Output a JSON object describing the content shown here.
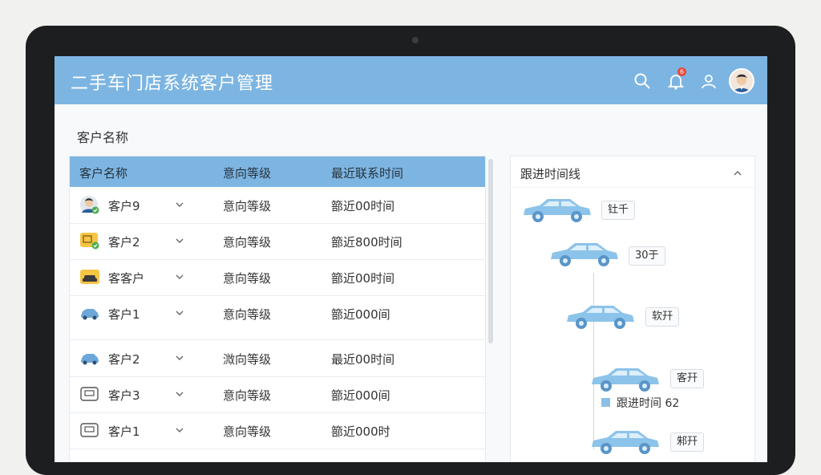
{
  "header": {
    "title": "二手车门店系统客户管理",
    "notification_count": "6"
  },
  "section_label": "客户名称",
  "table": {
    "headers": [
      "客户名称",
      "意向等级",
      "最近联系时间"
    ],
    "rows": [
      {
        "icon": "person-avatar-icon",
        "name": "客户9",
        "level": "意向等级",
        "time": "篰近00时间"
      },
      {
        "icon": "id-card-icon",
        "name": "客户2",
        "level": "意向等级",
        "time": "篰近800时间"
      },
      {
        "icon": "yellow-car-icon",
        "name": "客客户",
        "level": "意向等级",
        "time": "篰近00时间"
      },
      {
        "icon": "blue-car-icon",
        "name": "客户1",
        "level": "意向等级",
        "time": "篰近000间"
      },
      {
        "icon": "blue-car-icon",
        "name": "客户2",
        "level": "溦向等级",
        "time": "最近00时间"
      },
      {
        "icon": "card-icon",
        "name": "客户3",
        "level": "意向等级",
        "time": "篰近000间"
      },
      {
        "icon": "card-icon",
        "name": "客户1",
        "level": "意向等级",
        "time": "篰近000时"
      }
    ]
  },
  "timeline": {
    "title": "跟进时间线",
    "tags": [
      "钍千",
      "30于",
      "软幵",
      "客幵",
      "邾幵"
    ],
    "note": "跟进时间 62"
  },
  "colors": {
    "header_bg": "#7db5e2",
    "car_blue": "#8cc3ea",
    "badge_red": "#e94a3a"
  }
}
